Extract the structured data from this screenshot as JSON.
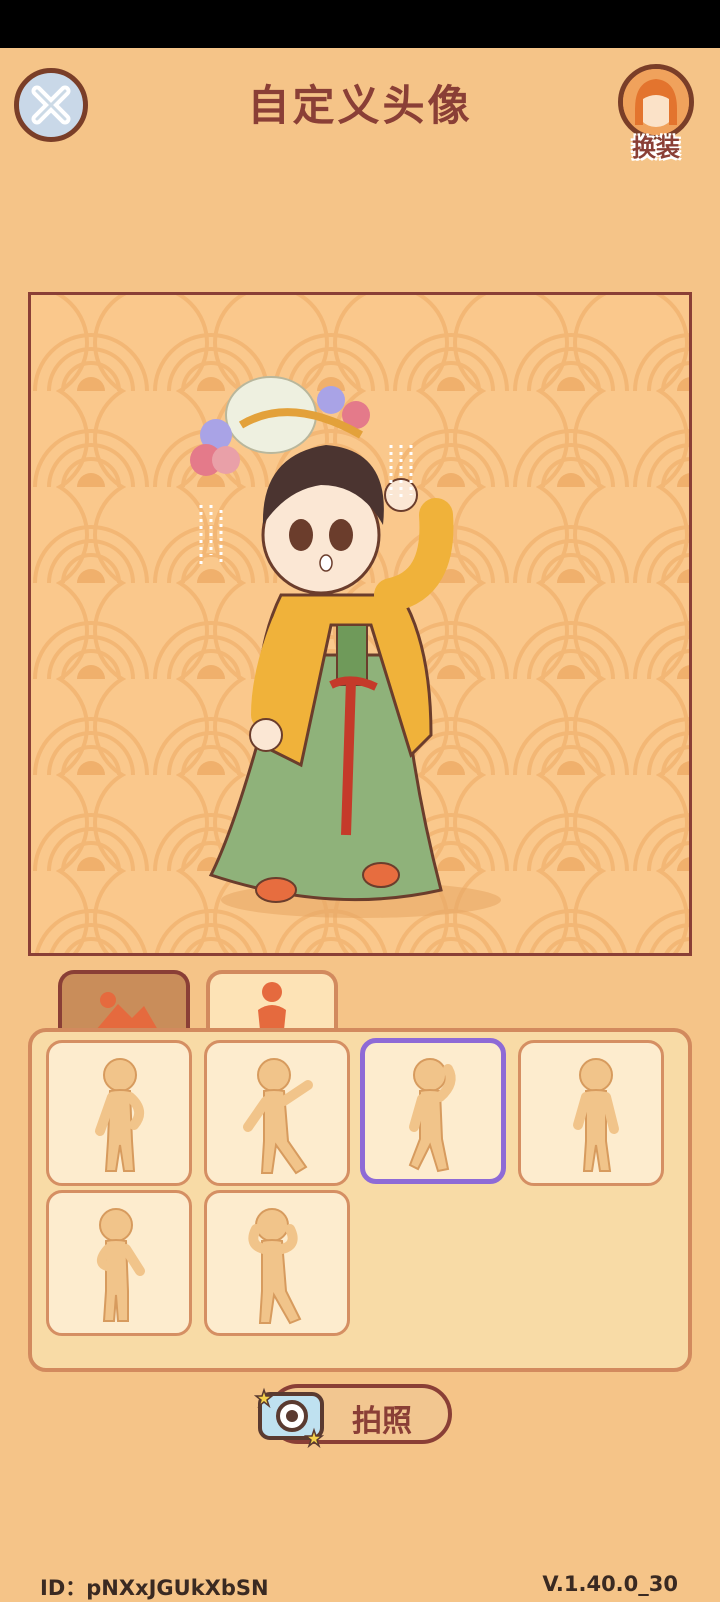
{
  "header": {
    "title": "自定义头像",
    "dressup_label": "换装"
  },
  "tabs": [
    {
      "id": "background",
      "icon": "mountain-icon",
      "active": true
    },
    {
      "id": "pose",
      "icon": "person-icon",
      "active": false
    }
  ],
  "poses": [
    {
      "id": "pose-1",
      "selected": false
    },
    {
      "id": "pose-2",
      "selected": false
    },
    {
      "id": "pose-3",
      "selected": true
    },
    {
      "id": "pose-4",
      "selected": false
    },
    {
      "id": "pose-5",
      "selected": false
    },
    {
      "id": "pose-6",
      "selected": false
    }
  ],
  "photo_button": {
    "label": "拍照",
    "icon": "camera-icon"
  },
  "footer": {
    "id_text": "ID：pNXxJGUkXbSN",
    "version": "V.1.40.0_30"
  },
  "colors": {
    "background": "#f5c488",
    "title": "#8a3f36",
    "selected_outline": "#8e6ad6"
  }
}
